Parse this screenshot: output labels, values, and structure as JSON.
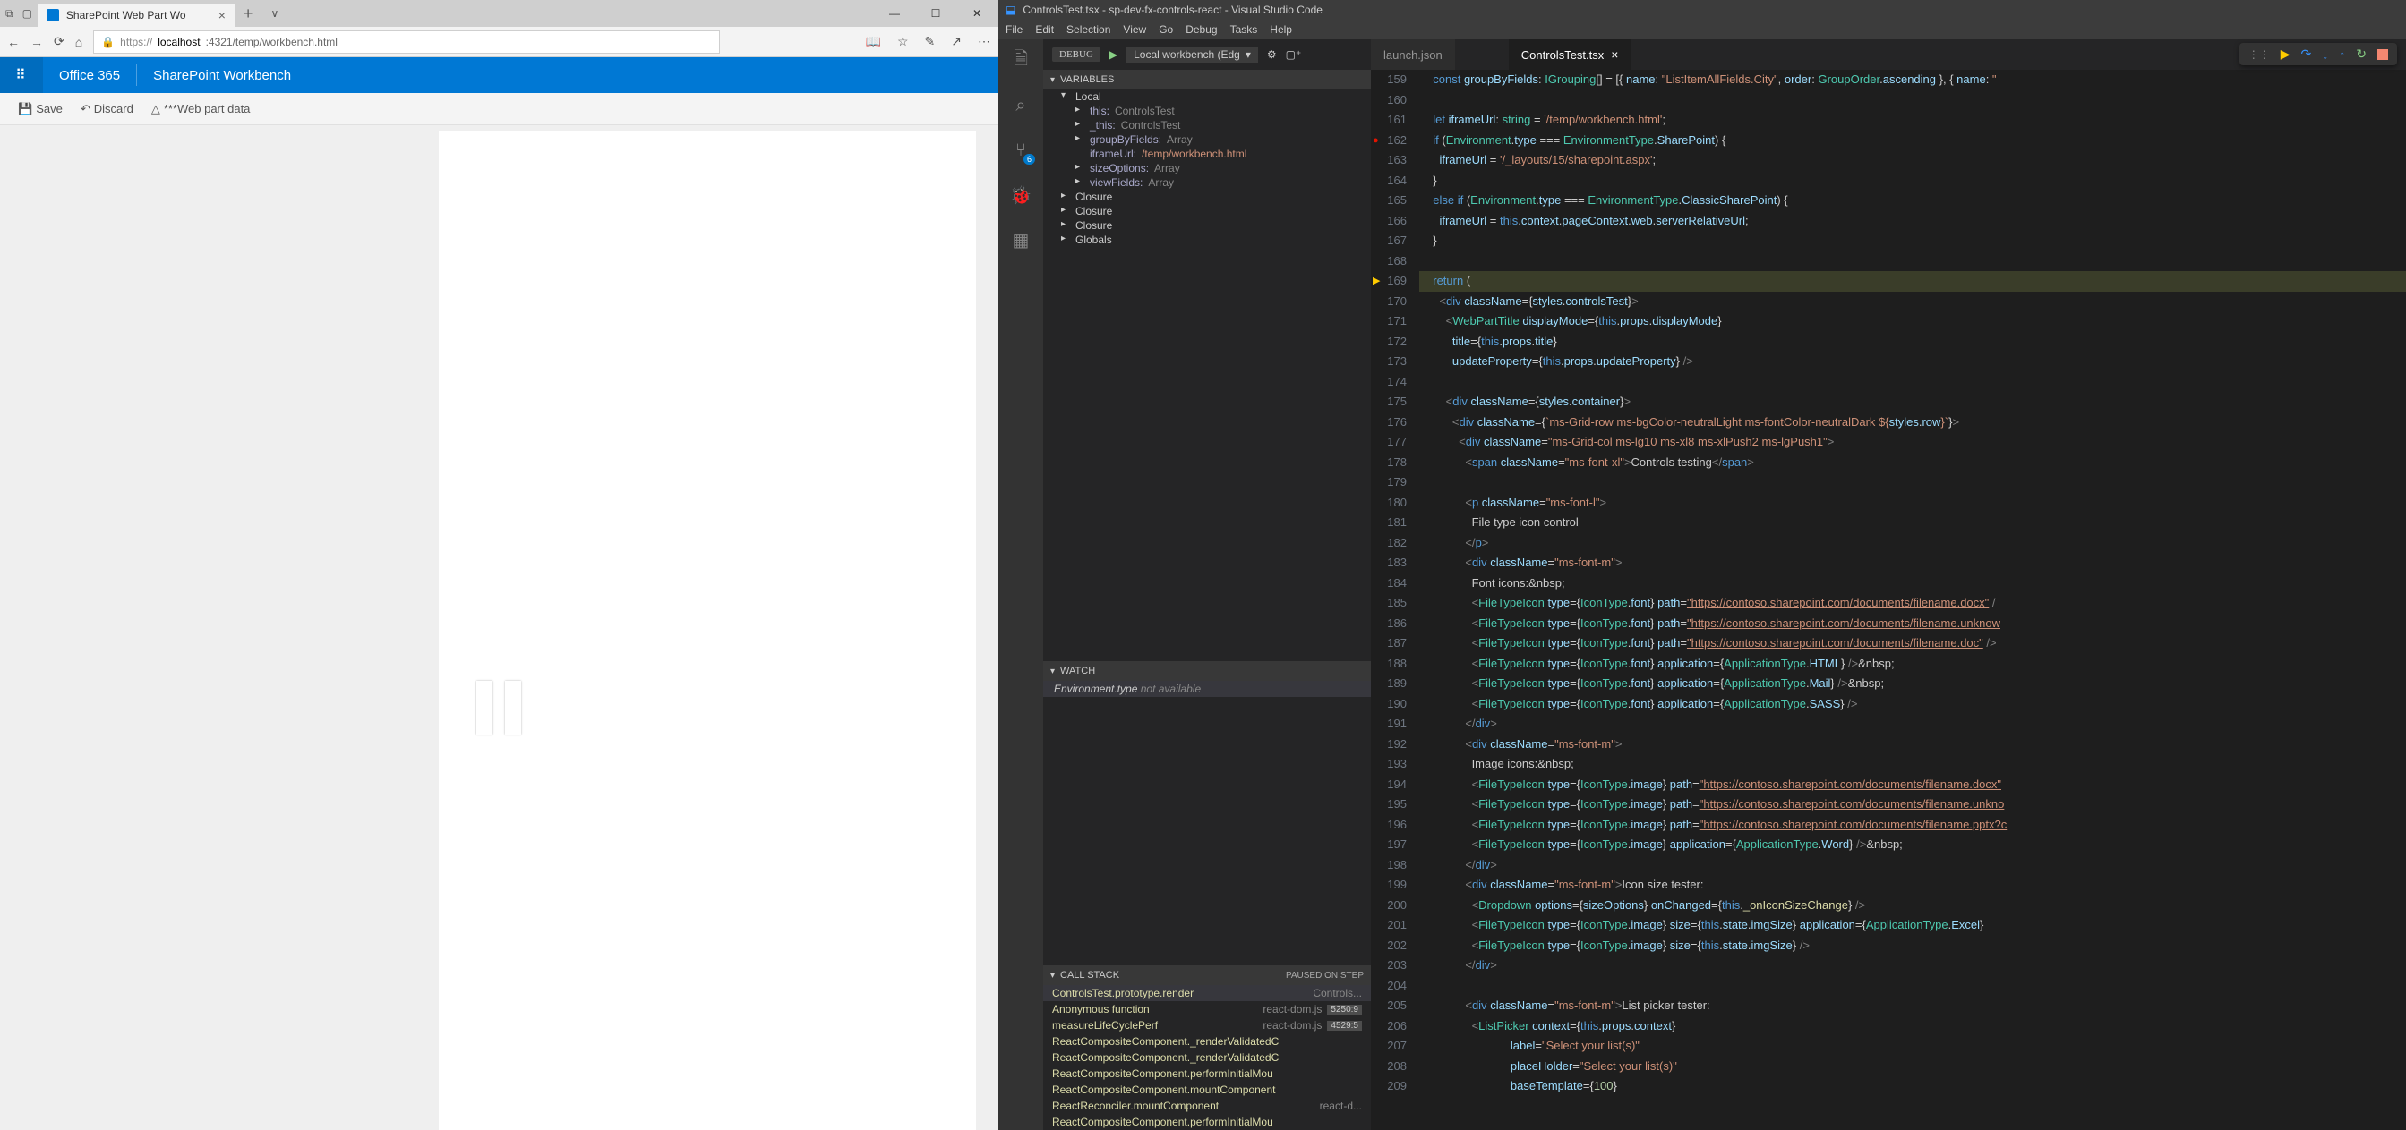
{
  "browser": {
    "tab_title": "SharePoint Web Part Wo",
    "url_prefix": "https://",
    "url_host": "localhost",
    "url_port_path": ":4321/temp/workbench.html",
    "header_brand": "Office 365",
    "header_title": "SharePoint Workbench",
    "cmd_save": "Save",
    "cmd_discard": "Discard",
    "cmd_webpart": "***Web part data"
  },
  "vscode": {
    "title": "ControlsTest.tsx - sp-dev-fx-controls-react - Visual Studio Code",
    "menu": [
      "File",
      "Edit",
      "Selection",
      "View",
      "Go",
      "Debug",
      "Tasks",
      "Help"
    ],
    "scm_badge": "6",
    "debug_label": "DEBUG",
    "debug_config": "Local workbench (Edg",
    "tabs": {
      "launch": "launch.json",
      "controls": "ControlsTest.tsx"
    },
    "panels": {
      "variables": "VARIABLES",
      "watch": "WATCH",
      "callstack": "CALL STACK",
      "callstack_state": "PAUSED ON STEP"
    },
    "variables": {
      "local": "Local",
      "this": {
        "name": "this:",
        "val": "ControlsTest"
      },
      "_this": {
        "name": "_this:",
        "val": "ControlsTest"
      },
      "groupByFields": {
        "name": "groupByFields:",
        "val": "Array"
      },
      "iframeUrl": {
        "name": "iframeUrl:",
        "val": "/temp/workbench.html"
      },
      "sizeOptions": {
        "name": "sizeOptions:",
        "val": "Array"
      },
      "viewFields": {
        "name": "viewFields:",
        "val": "Array"
      },
      "closure": "Closure",
      "globals": "Globals"
    },
    "watch": {
      "expr": "Environment.type",
      "state": "not available"
    },
    "callstack_th": {
      "fn": "ControlsTest.prototype.render",
      "src": "Controls..."
    },
    "callstack": [
      {
        "fn": "Anonymous function",
        "src": "react-dom.js",
        "ln": "5250:9"
      },
      {
        "fn": "measureLifeCyclePerf",
        "src": "react-dom.js",
        "ln": "4529:5"
      },
      {
        "fn": "ReactCompositeComponent._renderValidatedC",
        "src": "",
        "ln": ""
      },
      {
        "fn": "ReactCompositeComponent._renderValidatedC",
        "src": "",
        "ln": ""
      },
      {
        "fn": "ReactCompositeComponent.performInitialMou",
        "src": "",
        "ln": ""
      },
      {
        "fn": "ReactCompositeComponent.mountComponent",
        "src": "",
        "ln": ""
      },
      {
        "fn": "ReactReconciler.mountComponent",
        "src": "react-d...",
        "ln": ""
      },
      {
        "fn": "ReactCompositeComponent.performInitialMou",
        "src": "",
        "ln": ""
      }
    ],
    "code_start": 159,
    "code_breakpoint_line": 162,
    "code_current_line": 169
  }
}
